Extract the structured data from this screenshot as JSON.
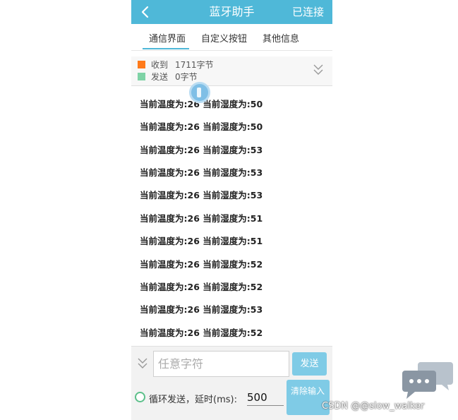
{
  "header": {
    "title": "蓝牙助手",
    "status": "已连接",
    "accent_color": "#4fb8d8"
  },
  "tabs": [
    {
      "label": "通信界面",
      "active": true
    },
    {
      "label": "自定义按钮",
      "active": false
    },
    {
      "label": "其他信息",
      "active": false
    }
  ],
  "stats": {
    "received_label": "收到",
    "received_value": "1711字节",
    "received_color": "#ff7a1a",
    "sent_label": "发送",
    "sent_value": "0字节",
    "sent_color": "#7fd3a6"
  },
  "log": [
    "当前温度为:26 当前湿度为:50",
    "当前温度为:26 当前湿度为:50",
    "当前温度为:26 当前湿度为:53",
    "当前温度为:26 当前湿度为:53",
    "当前温度为:26 当前湿度为:53",
    "当前温度为:26 当前湿度为:51",
    "当前温度为:26 当前湿度为:51",
    "当前温度为:26 当前湿度为:52",
    "当前温度为:26 当前湿度为:52",
    "当前温度为:26 当前湿度为:53",
    "当前温度为:26 当前湿度为:52"
  ],
  "input": {
    "placeholder": "任意字符",
    "value": ""
  },
  "send_button": "发送",
  "loop": {
    "label": "循环发送，延时(ms):",
    "checked": false,
    "delay_value": "500"
  },
  "clear_button": "清除输入",
  "watermark": "CSDN @@slow_walker",
  "icons": {
    "back": "back-arrow-icon",
    "collapse": "double-chevron-down-icon",
    "expand": "double-chevron-down-icon",
    "float": "floating-assist-icon",
    "chat": "chat-bubble-icon"
  }
}
